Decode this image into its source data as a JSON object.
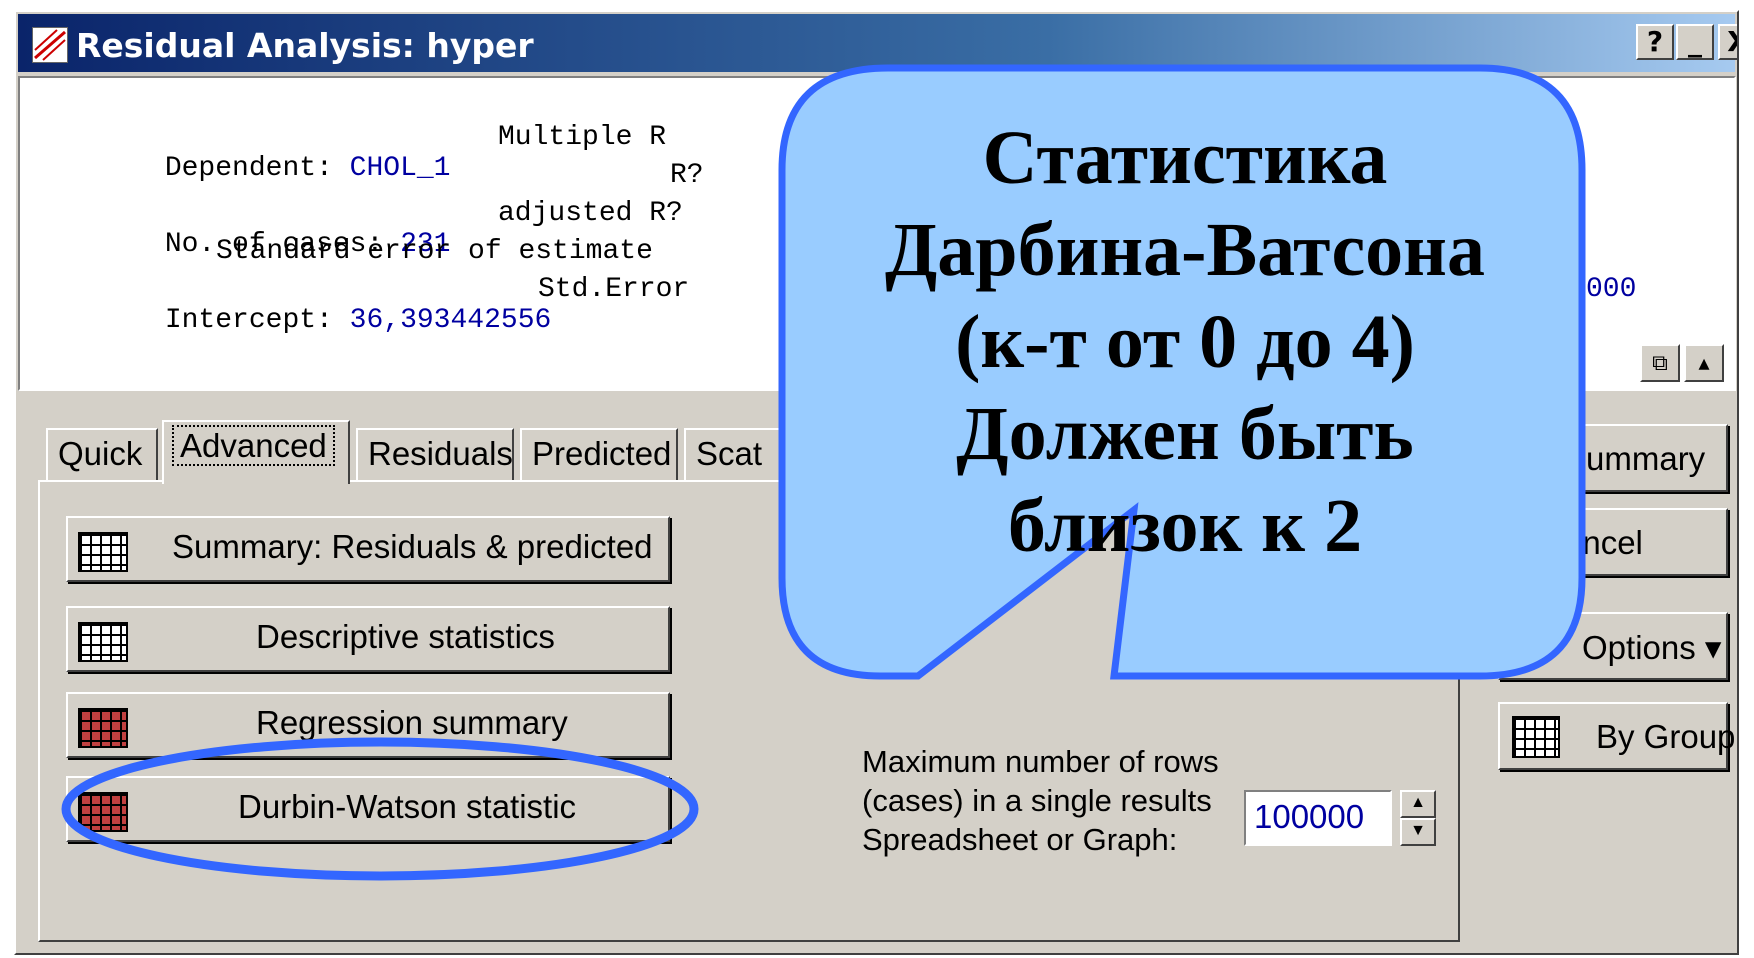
{
  "window": {
    "title": "Residual Analysis: hyper",
    "buttons": [
      "?",
      "_",
      "X"
    ]
  },
  "output": {
    "dependent_label": "Dependent:",
    "dependent_value": "CHOL_1",
    "multiple_r_label": "Multiple R",
    "r2_label": "R?",
    "cases_label": "No. of cases:",
    "cases_value": "231",
    "adjusted_label": "adjusted R?",
    "std_err_label": "Standard error of estimate",
    "intercept_label": "Intercept:",
    "intercept_value": "36,393442556",
    "std_error_label": "Std.Error",
    "right_value": "000"
  },
  "tabs": [
    "Quick",
    "Advanced",
    "Residuals",
    "Predicted",
    "Scat"
  ],
  "buttons": {
    "summary": "Summary:  Residuals & predicted",
    "descriptive": "Descriptive statistics",
    "regression": "Regression summary",
    "durbin": "Durbin-Watson statistic"
  },
  "side_buttons": {
    "summary": "Summary",
    "cancel": "ancel",
    "options": "Options ▾",
    "by_group": "By Group"
  },
  "max_rows": {
    "label": "Maximum number of rows\n(cases) in a single results\nSpreadsheet or Graph:",
    "value": "100000"
  },
  "callout": {
    "lines": [
      "Статистика",
      "Дарбина-Ватсона",
      "(к-т от 0 до 4)",
      "Должен быть",
      "близок к 2"
    ],
    "fill": "#99ccff",
    "stroke": "#3366ff"
  },
  "highlight": {
    "stroke": "#3366ff"
  }
}
